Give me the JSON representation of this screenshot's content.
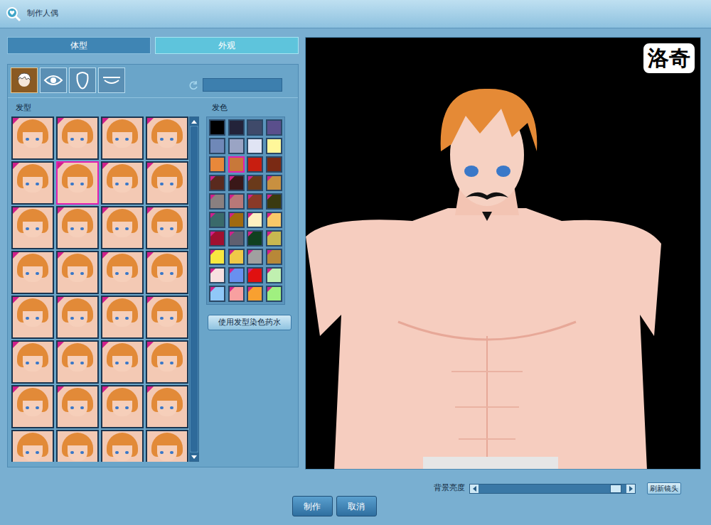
{
  "window": {
    "title": "制作人偶"
  },
  "tabs": [
    {
      "label": "体型",
      "selected": false
    },
    {
      "label": "外观",
      "selected": true
    }
  ],
  "part_tabs": [
    {
      "kind": "hair",
      "selected": true
    },
    {
      "kind": "eye",
      "selected": false
    },
    {
      "kind": "face",
      "selected": false
    },
    {
      "kind": "mouth",
      "selected": false
    }
  ],
  "search": {
    "value": ""
  },
  "hair_styles": {
    "label": "发型",
    "items": [
      {
        "selected": false,
        "badge": true
      },
      {
        "selected": false,
        "badge": true
      },
      {
        "selected": false,
        "badge": true
      },
      {
        "selected": false,
        "badge": true
      },
      {
        "selected": false,
        "badge": true
      },
      {
        "selected": true,
        "badge": true
      },
      {
        "selected": false,
        "badge": true
      },
      {
        "selected": false,
        "badge": true
      },
      {
        "selected": false,
        "badge": true
      },
      {
        "selected": false,
        "badge": true
      },
      {
        "selected": false,
        "badge": true
      },
      {
        "selected": false,
        "badge": true
      },
      {
        "selected": false,
        "badge": true
      },
      {
        "selected": false,
        "badge": true
      },
      {
        "selected": false,
        "badge": true
      },
      {
        "selected": false,
        "badge": true
      },
      {
        "selected": false,
        "badge": true
      },
      {
        "selected": false,
        "badge": true
      },
      {
        "selected": false,
        "badge": true
      },
      {
        "selected": false,
        "badge": true
      },
      {
        "selected": false,
        "badge": true
      },
      {
        "selected": false,
        "badge": true
      },
      {
        "selected": false,
        "badge": true
      },
      {
        "selected": false,
        "badge": true
      },
      {
        "selected": false,
        "badge": true
      },
      {
        "selected": false,
        "badge": true
      },
      {
        "selected": false,
        "badge": true
      },
      {
        "selected": false,
        "badge": true
      },
      {
        "selected": false,
        "badge": false
      },
      {
        "selected": false,
        "badge": false
      },
      {
        "selected": false,
        "badge": false
      },
      {
        "selected": false,
        "badge": false
      }
    ]
  },
  "hair_colors": {
    "label": "发色",
    "items": [
      {
        "color": "#000000",
        "selected": false,
        "badge": false
      },
      {
        "color": "#23233a",
        "selected": false,
        "badge": false
      },
      {
        "color": "#3f4a6a",
        "selected": false,
        "badge": false
      },
      {
        "color": "#5a4f8c",
        "selected": false,
        "badge": false
      },
      {
        "color": "#6f88b8",
        "selected": false,
        "badge": false
      },
      {
        "color": "#9aa4c4",
        "selected": false,
        "badge": false
      },
      {
        "color": "#e0e4f4",
        "selected": false,
        "badge": false
      },
      {
        "color": "#fff79a",
        "selected": false,
        "badge": false
      },
      {
        "color": "#e8883a",
        "selected": false,
        "badge": false
      },
      {
        "color": "#c8783a",
        "selected": true,
        "badge": false
      },
      {
        "color": "#c81e10",
        "selected": false,
        "badge": false
      },
      {
        "color": "#7a2a14",
        "selected": false,
        "badge": false
      },
      {
        "color": "#5a2a1e",
        "selected": false,
        "badge": true
      },
      {
        "color": "#3a1818",
        "selected": false,
        "badge": true
      },
      {
        "color": "#6a3a1a",
        "selected": false,
        "badge": true
      },
      {
        "color": "#c89040",
        "selected": false,
        "badge": true
      },
      {
        "color": "#8a8080",
        "selected": false,
        "badge": true
      },
      {
        "color": "#b87878",
        "selected": false,
        "badge": true
      },
      {
        "color": "#8a3a28",
        "selected": false,
        "badge": true
      },
      {
        "color": "#3a3a10",
        "selected": false,
        "badge": true
      },
      {
        "color": "#3a6a6a",
        "selected": false,
        "badge": true
      },
      {
        "color": "#a06a10",
        "selected": false,
        "badge": true
      },
      {
        "color": "#fff0c0",
        "selected": false,
        "badge": true
      },
      {
        "color": "#f8c868",
        "selected": false,
        "badge": true
      },
      {
        "color": "#a01030",
        "selected": false,
        "badge": true
      },
      {
        "color": "#606070",
        "selected": false,
        "badge": true
      },
      {
        "color": "#104020",
        "selected": false,
        "badge": true
      },
      {
        "color": "#c8b850",
        "selected": false,
        "badge": true
      },
      {
        "color": "#f8e840",
        "selected": false,
        "badge": true
      },
      {
        "color": "#f0c848",
        "selected": false,
        "badge": true
      },
      {
        "color": "#a0a0a0",
        "selected": false,
        "badge": true
      },
      {
        "color": "#b88838",
        "selected": false,
        "badge": true
      },
      {
        "color": "#f8e0e0",
        "selected": false,
        "badge": true
      },
      {
        "color": "#6890f0",
        "selected": false,
        "badge": true
      },
      {
        "color": "#e01010",
        "selected": false,
        "badge": true
      },
      {
        "color": "#c0f0b0",
        "selected": false,
        "badge": true
      },
      {
        "color": "#90c8f8",
        "selected": false,
        "badge": true
      },
      {
        "color": "#f8a0a0",
        "selected": false,
        "badge": true
      },
      {
        "color": "#f8a030",
        "selected": false,
        "badge": true
      },
      {
        "color": "#a0f080",
        "selected": false,
        "badge": true
      }
    ]
  },
  "dye_button": "使用发型染色药水",
  "preview": {
    "logo": "洛奇"
  },
  "background_brightness": {
    "label": "背景亮度",
    "level": 0.93
  },
  "refresh_button": "刷新镜头",
  "buttons": [
    "制作",
    "取消"
  ]
}
